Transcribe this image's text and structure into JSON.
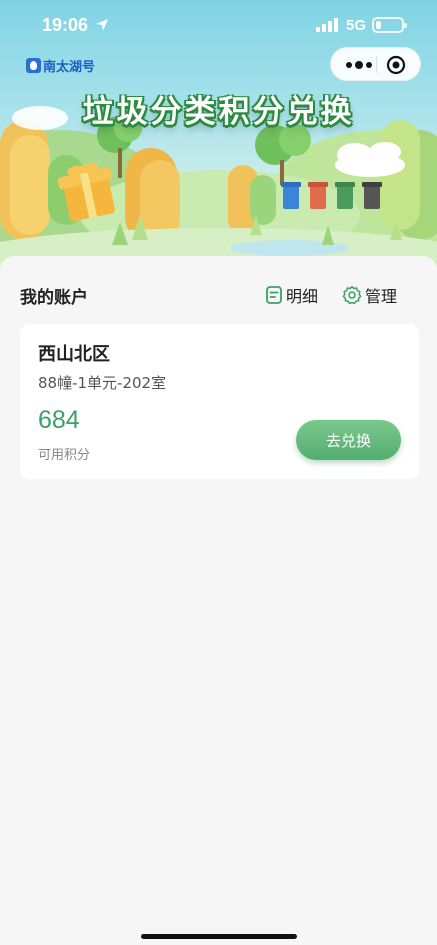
{
  "status_bar": {
    "time": "19:06",
    "network": "5G",
    "battery_level": 0.2
  },
  "header": {
    "logo_text": "南太湖号",
    "banner_title": "垃圾分类积分兑换"
  },
  "capsule": {
    "more_icon": "more-dots-icon",
    "close_icon": "target-close-icon"
  },
  "account": {
    "section_title": "我的账户",
    "detail_label": "明细",
    "manage_label": "管理",
    "card": {
      "community": "西山北区",
      "address": "88幢-1单元-202室",
      "points": "684",
      "points_label": "可用积分",
      "exchange_button": "去兑换"
    }
  },
  "colors": {
    "accent_green": "#3aa168",
    "button_green": "#5cb476",
    "hero_sky": "#7fd3e4"
  }
}
